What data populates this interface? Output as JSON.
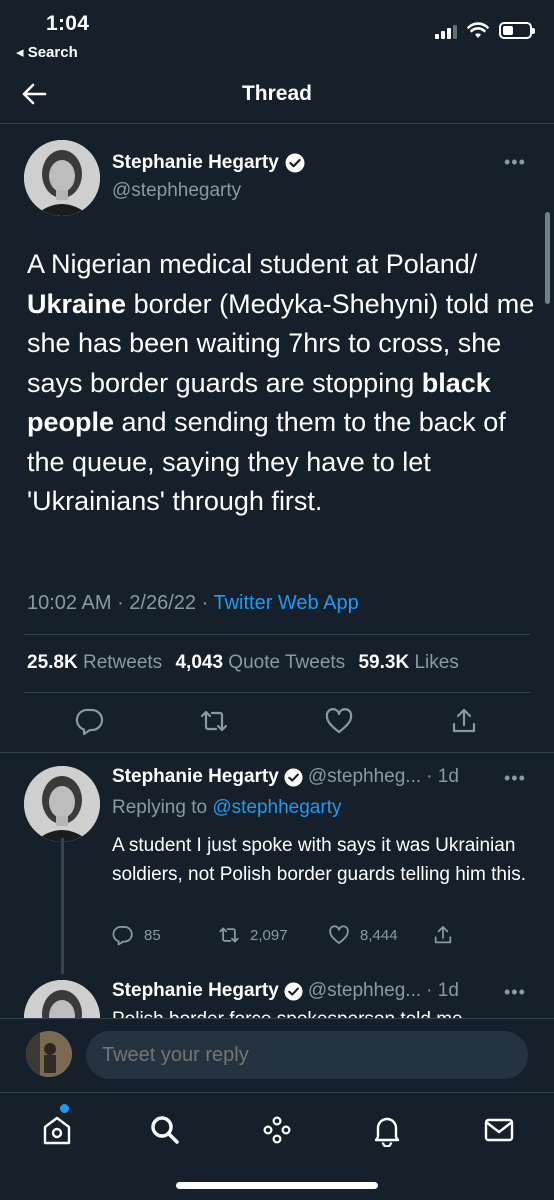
{
  "status_bar": {
    "time": "1:04",
    "back_label": "◂ Search"
  },
  "header": {
    "title": "Thread"
  },
  "main_tweet": {
    "author_name": "Stephanie Hegarty",
    "author_handle": "@stephhegarty",
    "text_parts": [
      "A Nigerian medical student at Poland/ ",
      "Ukraine",
      " border (Medyka-Shehyni) told me she has been waiting 7hrs to cross, she says border guards are stopping ",
      "black people",
      " and sending them to the back of the queue, saying they have to let 'Ukrainians' through first."
    ],
    "time": "10:02 AM",
    "date": "2/26/22",
    "source": "Twitter Web App",
    "stats": {
      "retweets_count": "25.8K",
      "retweets_label": "Retweets",
      "quotes_count": "4,043",
      "quotes_label": "Quote Tweets",
      "likes_count": "59.3K",
      "likes_label": "Likes"
    }
  },
  "replies": [
    {
      "author_name": "Stephanie Hegarty",
      "author_handle": "@stephheg...",
      "age": "· 1d",
      "replying_prefix": "Replying to",
      "replying_to": "@stephhegarty",
      "text": "A student I just spoke with says it was Ukrainian soldiers, not Polish border guards telling him this.",
      "replies_count": "85",
      "retweets_count": "2,097",
      "likes_count": "8,444"
    },
    {
      "author_name": "Stephanie Hegarty",
      "author_handle": "@stephheg...",
      "age": "· 1d",
      "text_partial": "Polish border force spokesperson told me"
    }
  ],
  "composer": {
    "placeholder": "Tweet your reply"
  },
  "colors": {
    "background": "#15202b",
    "accent": "#1d9bf0",
    "secondary_text": "#8b98a5",
    "divider": "#38444d"
  }
}
